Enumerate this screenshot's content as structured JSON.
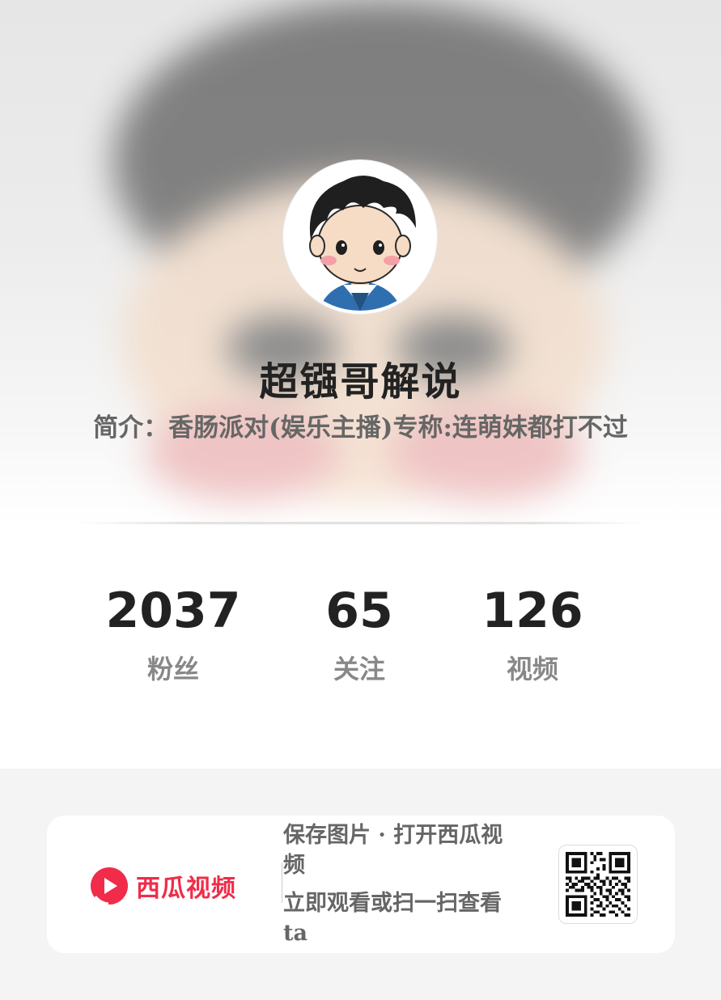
{
  "profile": {
    "name": "超镪哥解说",
    "bio": "简介：香肠派对(娱乐主播)专称:连萌妹都打不过",
    "avatar_icon": "cartoon-boy-avatar"
  },
  "stats": [
    {
      "value": "2037",
      "label": "粉丝"
    },
    {
      "value": "65",
      "label": "关注"
    },
    {
      "value": "126",
      "label": "视频"
    }
  ],
  "share_card": {
    "brand_name": "西瓜视频",
    "brand_color": "#f02c4a",
    "line1": "保存图片 · 打开西瓜视频",
    "line2": "立即观看或扫一扫查看ta",
    "qr_icon": "qr-code"
  }
}
